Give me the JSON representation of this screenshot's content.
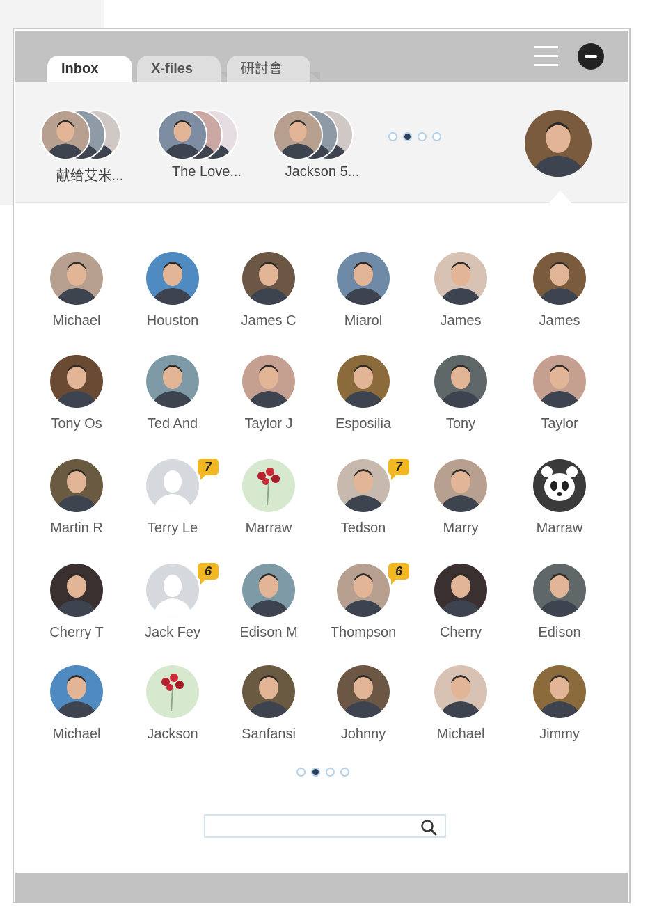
{
  "tabs": [
    {
      "label": "Inbox",
      "active": true
    },
    {
      "label": "X-files",
      "active": false
    },
    {
      "label": "研討會",
      "active": false
    }
  ],
  "recent_groups": [
    {
      "label": "献给艾米...",
      "colors": [
        "#b8a090",
        "#8e9aa6",
        "#d0c8c4"
      ]
    },
    {
      "label": "The Love...",
      "colors": [
        "#7e8da2",
        "#caa7a2",
        "#e6dde3"
      ]
    },
    {
      "label": "Jackson 5...",
      "colors": [
        "#b8a090",
        "#8e9aa6",
        "#d0c8c4"
      ]
    }
  ],
  "recent_pagination": {
    "pages": 4,
    "active": 1
  },
  "current_user": {
    "avatar": "man-portrait",
    "color": "#7a5b3e"
  },
  "contacts": [
    {
      "name": "Michael",
      "color": "#b8a090"
    },
    {
      "name": "Houston",
      "color": "#4f8bc0"
    },
    {
      "name": "James C",
      "color": "#6b5744"
    },
    {
      "name": "Miarol",
      "color": "#6f8aa6"
    },
    {
      "name": "James",
      "color": "#d8c2b4"
    },
    {
      "name": "James",
      "color": "#7a5b3e"
    },
    {
      "name": "Tony Os",
      "color": "#6a4a33"
    },
    {
      "name": "Ted And",
      "color": "#7e9aa6"
    },
    {
      "name": "Taylor J",
      "color": "#c59f8f"
    },
    {
      "name": "Esposilia",
      "color": "#8b6a3c"
    },
    {
      "name": "Tony",
      "color": "#5f6768"
    },
    {
      "name": "Taylor",
      "color": "#c59f8f"
    },
    {
      "name": "Martin R",
      "color": "#6b5a42"
    },
    {
      "name": "Terry Le",
      "color": "#d5d9de",
      "badge": "7",
      "placeholder": true
    },
    {
      "name": "Marraw",
      "color": "#d6e9cf",
      "flower": true
    },
    {
      "name": "Tedson",
      "color": "#c7b9ad",
      "badge": "7"
    },
    {
      "name": "Marry",
      "color": "#b8a090"
    },
    {
      "name": "Marraw",
      "color": "#3a3a3a",
      "panda": true
    },
    {
      "name": "Cherry T",
      "color": "#3b3030"
    },
    {
      "name": "Jack Fey",
      "color": "#d5d9de",
      "badge": "6",
      "placeholder": true
    },
    {
      "name": "Edison M",
      "color": "#7e9aa6"
    },
    {
      "name": "Thompson",
      "color": "#b8a090",
      "badge": "6"
    },
    {
      "name": "Cherry",
      "color": "#3b3030"
    },
    {
      "name": "Edison",
      "color": "#5f6768"
    },
    {
      "name": "Michael",
      "color": "#4f8bc0"
    },
    {
      "name": "Jackson",
      "color": "#d6e9cf",
      "flower": true
    },
    {
      "name": "Sanfansi",
      "color": "#6b5a42"
    },
    {
      "name": "Johnny",
      "color": "#6b5744"
    },
    {
      "name": "Michael",
      "color": "#d8c2b4"
    },
    {
      "name": "Jimmy",
      "color": "#8b6a3c"
    }
  ],
  "contacts_pagination": {
    "pages": 4,
    "active": 1
  },
  "search": {
    "placeholder": "",
    "value": ""
  },
  "icons": {
    "menu": "hamburger-icon",
    "remove": "minus-circle-icon",
    "search": "search-icon"
  }
}
